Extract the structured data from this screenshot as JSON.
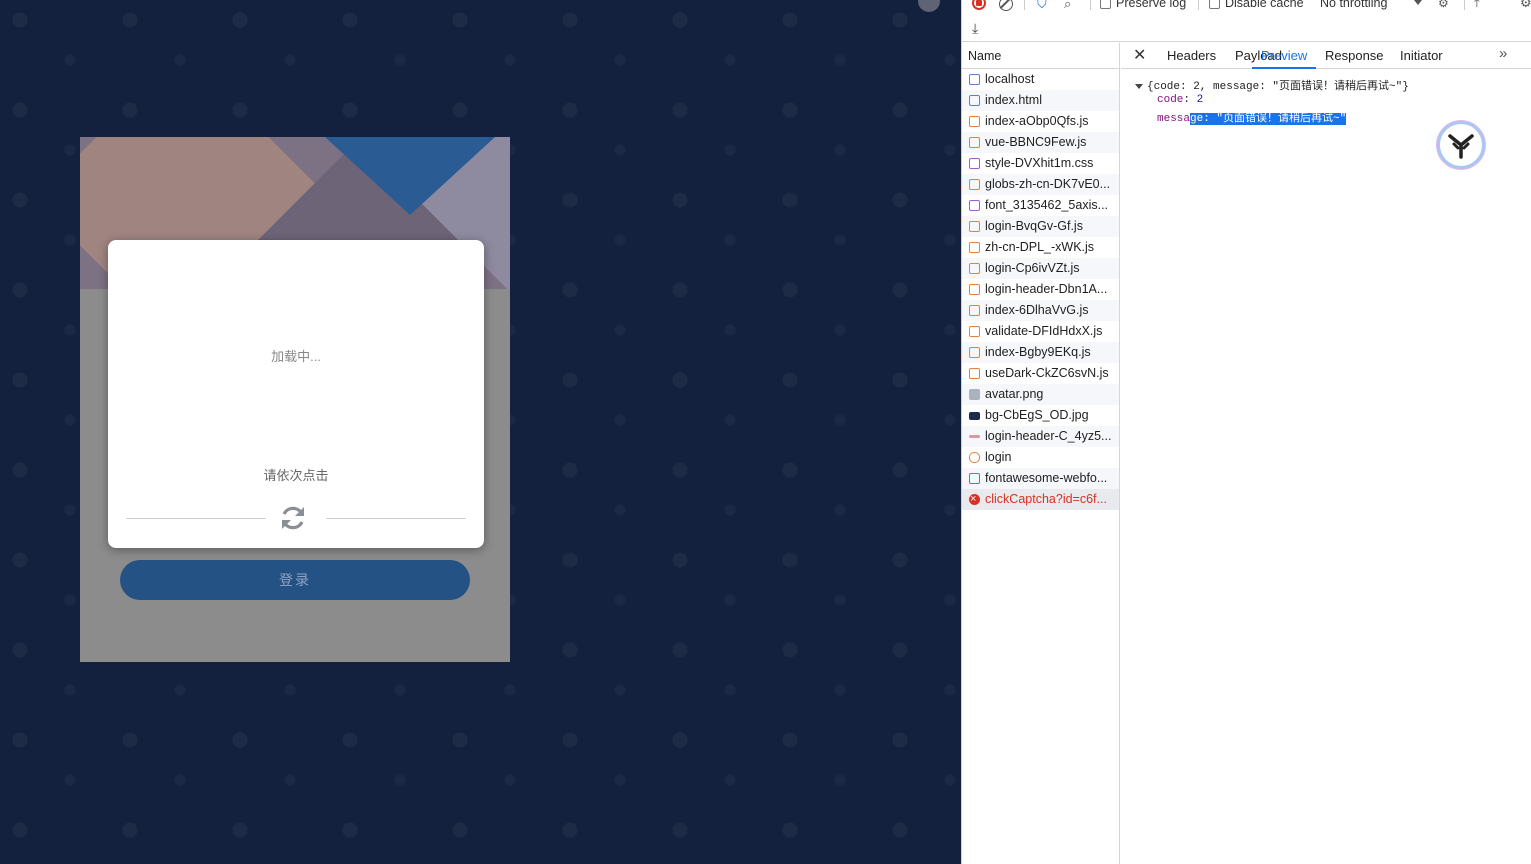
{
  "captcha": {
    "loading_text": "加载中...",
    "hint_text": "请依次点击"
  },
  "login": {
    "button_label": "登录"
  },
  "devtools": {
    "toolbar": {
      "preserve_log": "Preserve log",
      "disable_cache": "Disable cache",
      "throttling": "No throttling"
    },
    "name_header": "Name",
    "requests": [
      {
        "name": "localhost",
        "type": "doc"
      },
      {
        "name": "index.html",
        "type": "doc"
      },
      {
        "name": "index-aObp0Qfs.js",
        "type": "js"
      },
      {
        "name": "vue-BBNC9Few.js",
        "type": "js"
      },
      {
        "name": "style-DVXhit1m.css",
        "type": "css"
      },
      {
        "name": "globs-zh-cn-DK7vE0...",
        "type": "js"
      },
      {
        "name": "font_3135462_5axis...",
        "type": "css"
      },
      {
        "name": "login-BvqGv-Gf.js",
        "type": "js"
      },
      {
        "name": "zh-cn-DPL_-xWK.js",
        "type": "js"
      },
      {
        "name": "login-Cp6ivVZt.js",
        "type": "js"
      },
      {
        "name": "login-header-Dbn1A...",
        "type": "js"
      },
      {
        "name": "index-6DlhaVvG.js",
        "type": "js"
      },
      {
        "name": "validate-DFIdHdxX.js",
        "type": "js"
      },
      {
        "name": "index-Bgby9EKq.js",
        "type": "js"
      },
      {
        "name": "useDark-CkZC6svN.js",
        "type": "js"
      },
      {
        "name": "avatar.png",
        "type": "img"
      },
      {
        "name": "bg-CbEgS_OD.jpg",
        "type": "jpg"
      },
      {
        "name": "login-header-C_4yz5...",
        "type": "svg"
      },
      {
        "name": "login",
        "type": "xhr"
      },
      {
        "name": "fontawesome-webfo...",
        "type": "font"
      },
      {
        "name": "clickCaptcha?id=c6f...",
        "type": "err"
      }
    ],
    "tabs": {
      "headers": "Headers",
      "payload": "Payload",
      "preview": "Preview",
      "response": "Response",
      "initiator": "Initiator"
    },
    "preview": {
      "root": "{code: 2, message: \"页面错误！请稍后再试~\"}",
      "code_key": "code",
      "code_value": "2",
      "message_key_plain": "messa",
      "message_selected": "ge: \"页面错误！请稍后再试~\""
    }
  }
}
